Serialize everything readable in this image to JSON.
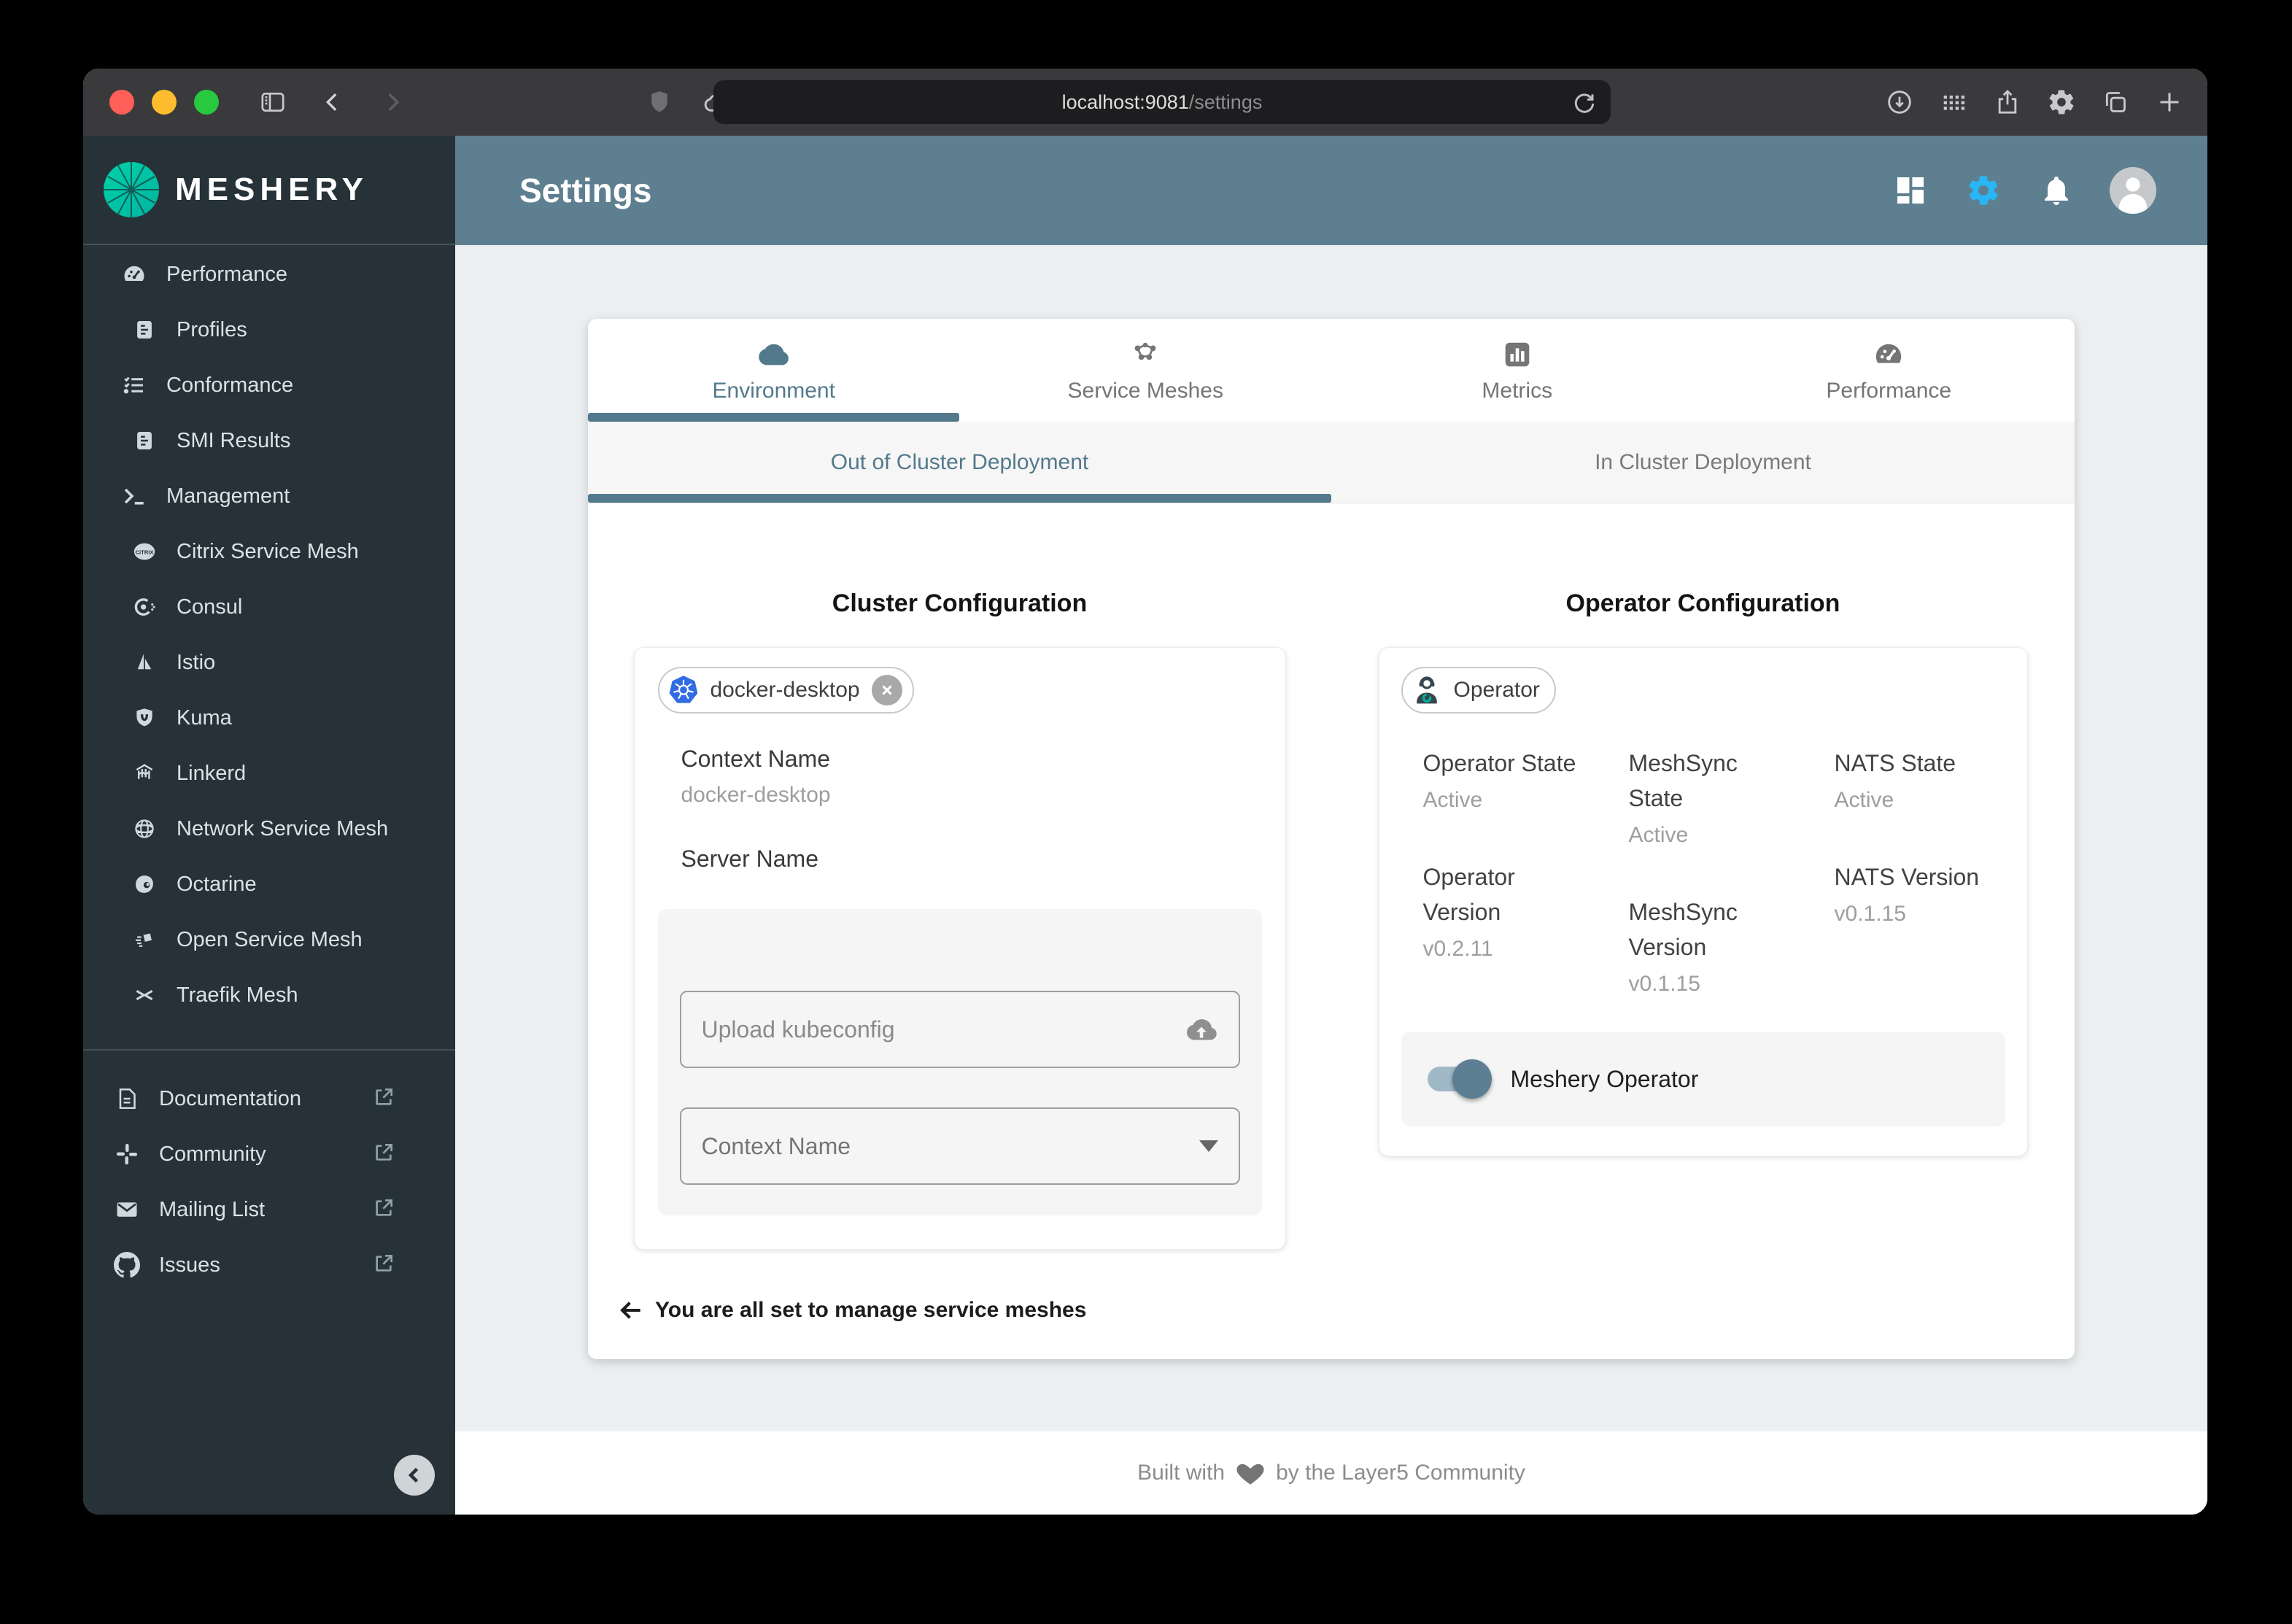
{
  "browser": {
    "url_host": "localhost:9081",
    "url_path": "/settings",
    "traffic_lights": [
      "#ff5f57",
      "#febc2e",
      "#28c840"
    ],
    "toolbar_icons": [
      "sidebar-toggle-icon",
      "back-icon",
      "forward-icon",
      "shield-icon",
      "cloud-icon",
      "refresh-icon",
      "download-icon",
      "grid-icon",
      "share-icon",
      "gear-icon",
      "copy-icon",
      "plus-icon"
    ]
  },
  "sidebar": {
    "brand": "MESHERY",
    "items": [
      {
        "label": "Performance",
        "icon": "speedometer-icon"
      },
      {
        "label": "Profiles",
        "icon": "document-icon"
      },
      {
        "label": "Conformance",
        "icon": "checklist-icon"
      },
      {
        "label": "SMI Results",
        "icon": "document-icon"
      },
      {
        "label": "Management",
        "icon": "terminal-icon"
      },
      {
        "label": "Citrix Service Mesh",
        "icon": "citrix-icon"
      },
      {
        "label": "Consul",
        "icon": "consul-icon"
      },
      {
        "label": "Istio",
        "icon": "istio-icon"
      },
      {
        "label": "Kuma",
        "icon": "kuma-icon"
      },
      {
        "label": "Linkerd",
        "icon": "linkerd-icon"
      },
      {
        "label": "Network Service Mesh",
        "icon": "network-service-mesh-icon"
      },
      {
        "label": "Octarine",
        "icon": "octarine-icon"
      },
      {
        "label": "Open Service Mesh",
        "icon": "open-service-mesh-icon"
      },
      {
        "label": "Traefik Mesh",
        "icon": "traefik-mesh-icon"
      }
    ],
    "links": [
      {
        "label": "Documentation",
        "icon": "document-icon"
      },
      {
        "label": "Community",
        "icon": "slack-icon"
      },
      {
        "label": "Mailing List",
        "icon": "mail-icon"
      },
      {
        "label": "Issues",
        "icon": "github-icon"
      }
    ]
  },
  "header": {
    "title": "Settings",
    "icons": [
      "dashboard-icon",
      "gear-icon",
      "bell-icon",
      "avatar"
    ]
  },
  "main": {
    "tabs": [
      {
        "label": "Environment",
        "icon": "cloud-icon",
        "selected": true
      },
      {
        "label": "Service Meshes",
        "icon": "mesh-icon",
        "selected": false
      },
      {
        "label": "Metrics",
        "icon": "bar-chart-icon",
        "selected": false
      },
      {
        "label": "Performance",
        "icon": "gauge-icon",
        "selected": false
      }
    ],
    "subtabs": [
      {
        "label": "Out of Cluster Deployment",
        "selected": true
      },
      {
        "label": "In Cluster Deployment",
        "selected": false
      }
    ],
    "cluster": {
      "title": "Cluster Configuration",
      "chip_label": "docker-desktop",
      "chip_icon": "kubernetes-icon",
      "context_label": "Context Name",
      "context_value": "docker-desktop",
      "server_label": "Server Name",
      "upload_placeholder": "Upload kubeconfig",
      "select_placeholder": "Context Name"
    },
    "operator": {
      "title": "Operator Configuration",
      "chip_label": "Operator",
      "chip_icon": "operator-icon",
      "stats": [
        {
          "label": "Operator State",
          "value": "Active"
        },
        {
          "label": "MeshSync State",
          "value": "Active"
        },
        {
          "label": "NATS State",
          "value": "Active"
        },
        {
          "label": "Operator Version",
          "value": "v0.2.11"
        },
        {
          "label": "MeshSync Version",
          "value": "v0.1.15"
        },
        {
          "label": "NATS Version",
          "value": "v0.1.15"
        }
      ],
      "toggle_label": "Meshery Operator",
      "toggle_on": true
    },
    "status_message": "You are all set to manage service meshes"
  },
  "footer": {
    "pre": "Built with",
    "heart_icon": "heart-icon",
    "post": "by the Layer5 Community"
  },
  "colors": {
    "accent": "#53798c",
    "header_bg": "#5e7f90",
    "sidebar_bg": "#263238",
    "gear_blue": "#29b6f6",
    "kubernetes_blue": "#326ce5",
    "logo_teal": "#00d3a9",
    "toggle_thumb": "#5d7f93"
  }
}
